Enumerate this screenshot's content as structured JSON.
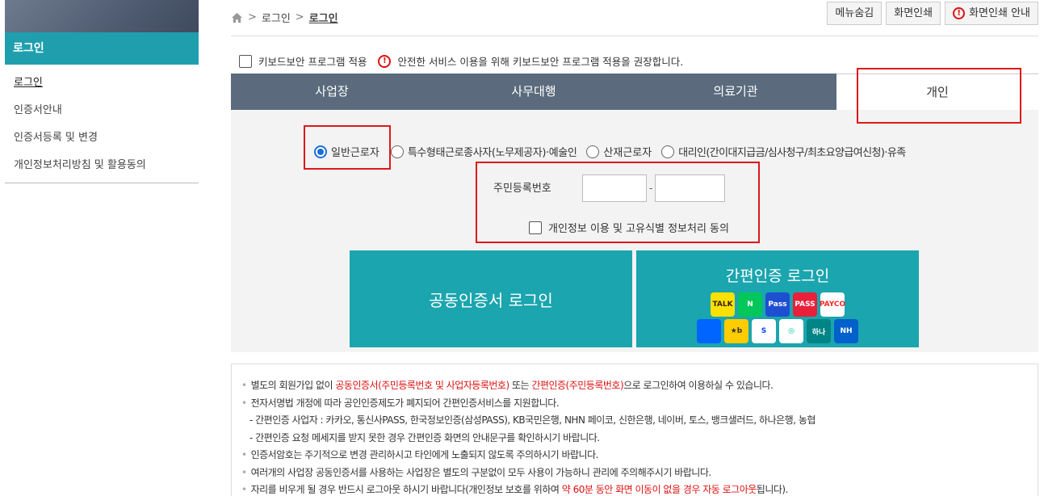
{
  "sidebar": {
    "title": "로그인",
    "items": [
      {
        "label": "로그인"
      },
      {
        "label": "인증서안내"
      },
      {
        "label": "인증서등록 및 변경"
      },
      {
        "label": "개인정보처리방침 및 활용동의"
      }
    ]
  },
  "breadcrumb": [
    "로그인",
    "로그인"
  ],
  "top_buttons": {
    "hide_menu": "메뉴숨김",
    "print": "화면인쇄",
    "print_guide": "화면인쇄 안내"
  },
  "keyboard": {
    "label": "키보드보안 프로그램 적용",
    "notice": "안전한 서비스 이용을 위해 키보드보안 프로그램 적용을 권장합니다."
  },
  "tabs": [
    {
      "label": "사업장"
    },
    {
      "label": "사무대행"
    },
    {
      "label": "의료기관"
    },
    {
      "label": "개인"
    }
  ],
  "radio_options": [
    {
      "label": "일반근로자",
      "selected": true
    },
    {
      "label": "특수형태근로종사자(노무제공자)·예술인",
      "selected": false
    },
    {
      "label": "산재근로자",
      "selected": false
    },
    {
      "label": "대리인(간이대지급금/심사청구/최초요양급여신청)·유족",
      "selected": false
    }
  ],
  "rrn": {
    "label": "주민등록번호",
    "dash": "-"
  },
  "agree": {
    "label": "개인정보 이용 및 고유식별 정보처리 동의"
  },
  "buttons": {
    "cert_login": "공동인증서 로그인",
    "simple_login": "간편인증 로그인"
  },
  "auth_icons": [
    {
      "name": "kakao-talk-icon",
      "text": "TALK",
      "bg": "#fae100",
      "color": "#3b1e1e"
    },
    {
      "name": "naver-icon",
      "text": "N",
      "bg": "#03c75a",
      "color": "#ffffff"
    },
    {
      "name": "samsung-pass-icon",
      "text": "Pass",
      "bg": "#1f4fd1",
      "color": "#ffffff"
    },
    {
      "name": "pass-icon",
      "text": "PASS",
      "bg": "#e8203a",
      "color": "#ffffff"
    },
    {
      "name": "payco-icon",
      "text": "PAYCO",
      "bg": "#ffffff",
      "color": "#fa2828"
    },
    {
      "name": "toss-icon",
      "text": "",
      "bg": "#0064ff",
      "color": "#ffffff"
    },
    {
      "name": "kb-icon",
      "text": "★b",
      "bg": "#ffcc00",
      "color": "#333333"
    },
    {
      "name": "shinhan-icon",
      "text": "S",
      "bg": "#ffffff",
      "color": "#0046ff"
    },
    {
      "name": "banksalad-icon",
      "text": "◎",
      "bg": "#ffffff",
      "color": "#00c0a5"
    },
    {
      "name": "hana-icon",
      "text": "하나",
      "bg": "#008485",
      "color": "#ffffff"
    },
    {
      "name": "nh-icon",
      "text": "NH",
      "bg": "#0060cc",
      "color": "#ffffff"
    }
  ],
  "notice": {
    "line1_a": "별도의 회원가입 없이 ",
    "line1_red1": "공동인증서(주민등록번호 및 사업자등록번호)",
    "line1_b": " 또는 ",
    "line1_red2": "간편인증(주민등록번호)",
    "line1_c": "으로 로그인하여 이용하실 수 있습니다.",
    "line2": "전자서명법 개정에 따라 공인인증제도가 폐지되어 간편인증서비스를 지원합니다.",
    "line3": "- 간편인증 사업자 : 카카오, 통신사PASS, 한국정보인증(삼성PASS), KB국민은행, NHN 페이코, 신한은행, 네이버, 토스, 뱅크샐러드, 하나은행, 농협",
    "line4": "- 간편인증 요청 메세지를 받지 못한 경우 간편인증 화면의 안내문구를 확인하시기 바랍니다.",
    "line5": "인증서암호는 주기적으로 변경 관리하시고 타인에게 노출되지 않도록 주의하시기 바랍니다.",
    "line6": "여러개의 사업장 공동인증서를 사용하는 사업장은 별도의 구분없이 모두 사용이 가능하니 관리에 주의해주시기 바랍니다.",
    "line7_a": "자리를 비우게 될 경우 반드시 로그아웃 하시기 바랍니다(개인정보 보호를 위하여 ",
    "line7_red": "약 60분 동안 화면 이동이 없을 경우 자동 로그아웃",
    "line7_b": "됩니다)."
  },
  "colors": {
    "accent": "#1ba5ae",
    "tab_bg": "#5b6b7d",
    "highlight": "#e01818"
  }
}
